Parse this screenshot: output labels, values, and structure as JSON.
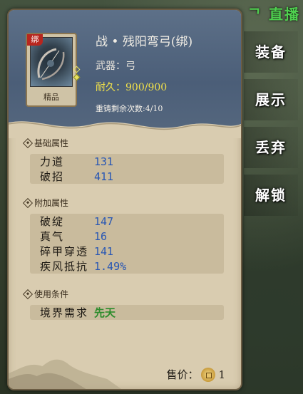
{
  "background": {
    "top_text": "ᄀ 直播"
  },
  "item": {
    "name": "战 • 残阳弯弓(绑)",
    "bound_tag": "绑",
    "quality": "精品",
    "type_label": "武器：弓",
    "durability_label": "耐久：",
    "durability_current": "900",
    "durability_max": "/900",
    "recast": "重铸剩余次数:4/10"
  },
  "sections": {
    "basic": {
      "title": "基础属性",
      "rows": [
        {
          "name": "力道",
          "value": "131"
        },
        {
          "name": "破招",
          "value": "411"
        }
      ]
    },
    "extra": {
      "title": "附加属性",
      "rows": [
        {
          "name": "破绽",
          "value": "147"
        },
        {
          "name": "真气",
          "value": "16"
        },
        {
          "name": "碎甲穿透",
          "value": "141"
        },
        {
          "name": "疾风抵抗",
          "value": "1.49%"
        }
      ]
    },
    "requirement": {
      "title": "使用条件",
      "rows": [
        {
          "name": "境界需求",
          "value": "先天"
        }
      ]
    }
  },
  "price": {
    "label": "售价：",
    "value": "1"
  },
  "actions": {
    "equip": "装备",
    "show": "展示",
    "discard": "丢弃",
    "unlock": "解锁"
  },
  "colors": {
    "header_bg": "#4b5e78",
    "panel_bg": "#d9ccb0",
    "durability": "#f0e04a",
    "attr_value": "#2756b4",
    "req_value": "#2c8c2c"
  },
  "icons": [
    "bow-item-icon",
    "coin-icon",
    "section-diamond-icon"
  ]
}
